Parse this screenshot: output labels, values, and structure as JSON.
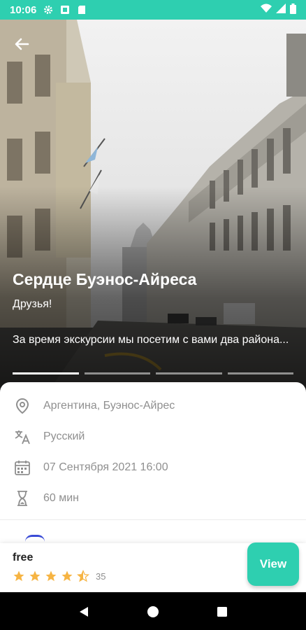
{
  "status_bar": {
    "time": "10:06",
    "icons": [
      "settings-icon",
      "sim-icon",
      "sd-card-icon",
      "wifi-icon",
      "signal-icon",
      "battery-icon"
    ]
  },
  "hero": {
    "title": "Сердце Буэнос-Айреса",
    "subtitle": "Друзья!",
    "description": "За время экскурсии мы посетим с вами два района...",
    "progress_segments": 4,
    "active_segment": 0
  },
  "details": {
    "location": "Аргентина, Буэнос-Айрес",
    "language": "Русский",
    "datetime": "07 Сентября 2021 16:00",
    "duration": "60 мин"
  },
  "booking": {
    "price": "free",
    "rating": 4.5,
    "reviews_count": "35",
    "view_label": "View"
  },
  "colors": {
    "accent": "#2ecfb0",
    "star": "#f6b443",
    "muted_text": "#8f8f8f"
  }
}
